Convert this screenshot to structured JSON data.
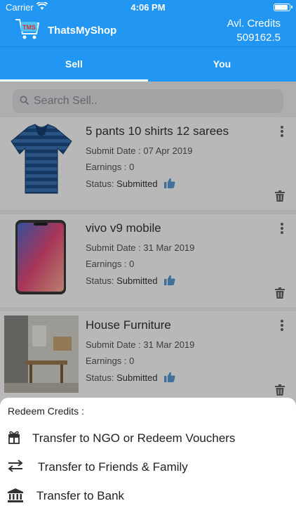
{
  "status_bar": {
    "carrier": "Carrier",
    "time": "4:06 PM"
  },
  "header": {
    "app_name": "ThatsMyShop",
    "logo_text": "TMS",
    "credits_label": "Avl. Credits",
    "credits_value": "509162.5"
  },
  "tabs": [
    {
      "label": "Sell",
      "active": true
    },
    {
      "label": "You",
      "active": false
    }
  ],
  "search": {
    "placeholder": "Search Sell.."
  },
  "items": [
    {
      "title": "5 pants 10 shirts 12 sarees",
      "date_label": "Submit Date :",
      "date": "07 Apr 2019",
      "earnings_label": "Earnings :",
      "earnings": "0",
      "status_label": "Status:",
      "status": "Submitted",
      "image": "shirt"
    },
    {
      "title": "vivo v9 mobile",
      "date_label": "Submit Date :",
      "date": "31 Mar 2019",
      "earnings_label": "Earnings :",
      "earnings": "0",
      "status_label": "Status:",
      "status": "Submitted",
      "image": "phone"
    },
    {
      "title": "House Furniture",
      "date_label": "Submit Date :",
      "date": "31 Mar 2019",
      "earnings_label": "Earnings :",
      "earnings": "0",
      "status_label": "Status:",
      "status": "Submitted",
      "image": "furniture"
    }
  ],
  "redeem_sheet": {
    "title": "Redeem Credits :",
    "options": [
      {
        "label": "Transfer to NGO or Redeem Vouchers",
        "icon": "gift-icon"
      },
      {
        "label": "Transfer to Friends & Family",
        "icon": "transfer-arrows-icon"
      },
      {
        "label": "Transfer to Bank",
        "icon": "bank-icon"
      }
    ]
  },
  "colors": {
    "primary": "#2196f3",
    "thumb": "#5b9bd5"
  }
}
